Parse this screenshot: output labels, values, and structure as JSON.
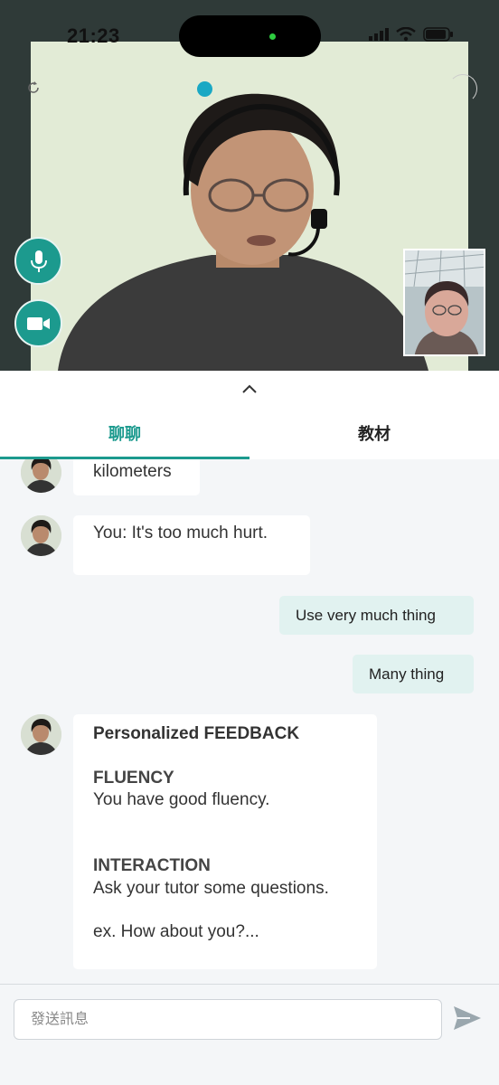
{
  "status_bar": {
    "time": "21:23"
  },
  "tabs": [
    {
      "label": "聊聊",
      "active": true
    },
    {
      "label": "教材",
      "active": false
    }
  ],
  "chat": {
    "messages": [
      {
        "from": "tutor",
        "text": "kilometers"
      },
      {
        "from": "tutor",
        "text": "You: It's too much hurt."
      },
      {
        "from": "user",
        "text": "Use very much thing"
      },
      {
        "from": "user",
        "text": "Many thing"
      }
    ],
    "feedback": {
      "title": "Personalized FEEDBACK",
      "section1_heading": "FLUENCY",
      "section1_text": "You have good fluency.",
      "section2_heading": "INTERACTION",
      "section2_text": "Ask your tutor some questions.",
      "example": "ex. How about you?..."
    }
  },
  "input": {
    "placeholder": "發送訊息",
    "value": ""
  },
  "colors": {
    "accent": "#1c9a8e",
    "bubble_out": "#e1f2f0",
    "video_bg": "#2f3a38"
  },
  "icons": [
    "microphone-icon",
    "video-camera-icon",
    "send-icon",
    "chevron-up-icon",
    "rotate-icon"
  ]
}
